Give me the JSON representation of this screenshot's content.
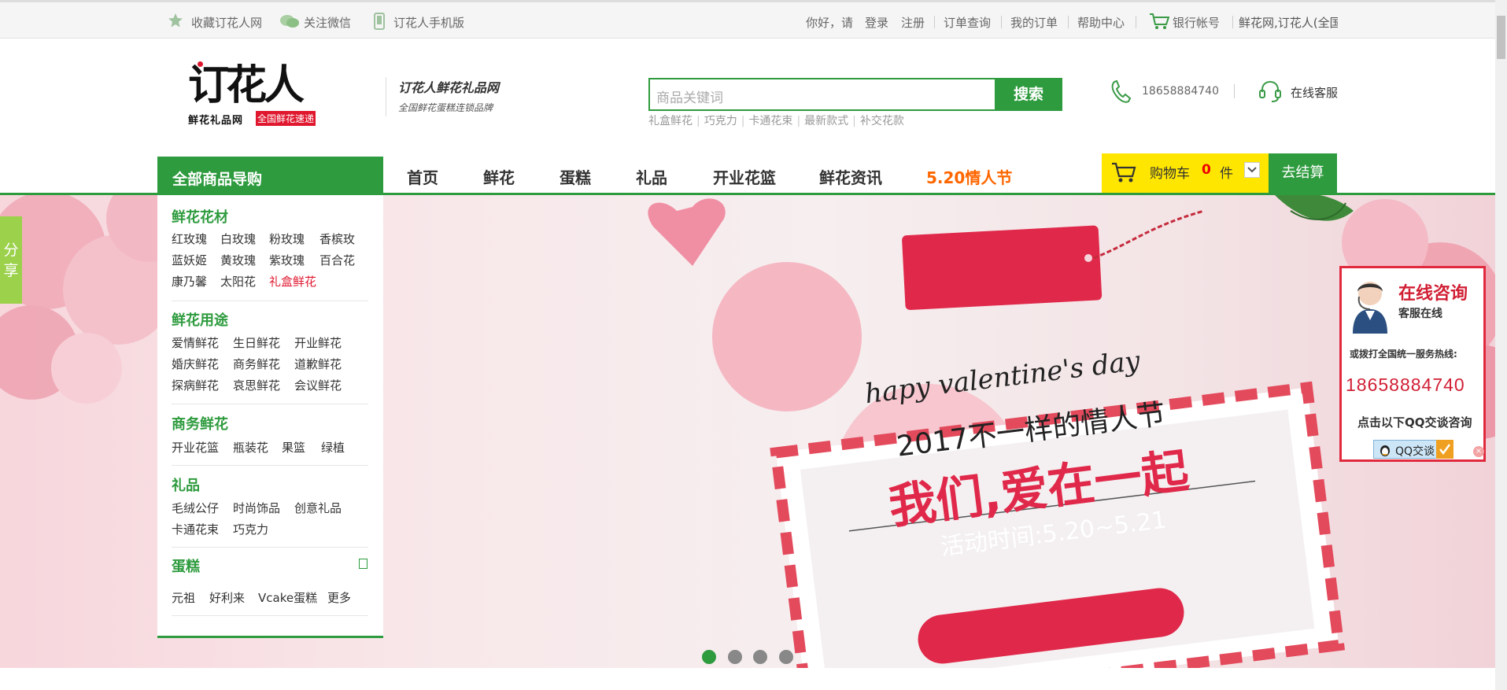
{
  "topbar": {
    "favorite": "收藏订花人网",
    "wechat": "关注微信",
    "mobile": "订花人手机版",
    "greeting": "你好，请",
    "login": "登录",
    "register": "注册",
    "order_query": "订单查询",
    "my_orders": "我的订单",
    "help": "帮助中心",
    "bank": "银行帐号",
    "ticker": "鲜花网,订花人(全国连"
  },
  "header": {
    "logo_text": "订花人",
    "logo_sub": "鲜花礼品网",
    "logo_tag": "全国鲜花速递",
    "slogan_line1": "订花人鲜花礼品网",
    "slogan_line2": "全国鲜花蛋糕连锁品牌",
    "search_placeholder": "商品关键词",
    "search_button": "搜索",
    "hotwords": [
      "礼盒鲜花",
      "巧克力",
      "卡通花束",
      "最新款式",
      "补交花款"
    ],
    "phone": "18658884740",
    "service": "在线客服"
  },
  "nav": {
    "all_categories": "全部商品导购",
    "items": [
      "首页",
      "鲜花",
      "蛋糕",
      "礼品",
      "开业花篮",
      "鲜花资讯"
    ],
    "promo": "5.20情人节",
    "cart_label": "购物车",
    "cart_count": "0",
    "cart_unit": "件",
    "checkout": "去结算"
  },
  "categories": {
    "flowers_title": "鲜花花材",
    "flowers": [
      "红玫瑰",
      "白玫瑰",
      "粉玫瑰",
      "香槟玫",
      "蓝妖姬",
      "黄玫瑰",
      "紫玫瑰",
      "百合花",
      "康乃馨",
      "太阳花",
      "礼盒鲜花"
    ],
    "usage_title": "鲜花用途",
    "usage": [
      "爱情鲜花",
      "生日鲜花",
      "开业鲜花",
      "婚庆鲜花",
      "商务鲜花",
      "道歉鲜花",
      "探病鲜花",
      "哀思鲜花",
      "会议鲜花"
    ],
    "business_title": "商务鲜花",
    "business": [
      "开业花篮",
      "瓶装花",
      "果篮",
      "绿植"
    ],
    "gifts_title": "礼品",
    "gifts": [
      "毛绒公仔",
      "时尚饰品",
      "创意礼品",
      "卡通花束",
      "巧克力"
    ],
    "cakes_title": "蛋糕",
    "cakes": [
      "元祖",
      "好利来",
      "Vcake蛋糕",
      "更多"
    ]
  },
  "share": "分享",
  "banner": {
    "line1": "hapy valentine's day",
    "line2": "2017不一样的情人节",
    "line3": "我们,爱在一起",
    "line4": "活动时间:5.20~5.21"
  },
  "qq": {
    "title": "在线咨询",
    "status": "客服在线",
    "hotline_label": "或拨打全国统一服务热线:",
    "phone": "18658884740",
    "click_hint": "点击以下QQ交谈咨询",
    "button": "QQ交谈"
  },
  "colors": {
    "brand_green": "#2e9b3e",
    "cart_yellow": "#ffe600",
    "promo_orange": "#ff6600",
    "qq_red": "#d11f34"
  }
}
